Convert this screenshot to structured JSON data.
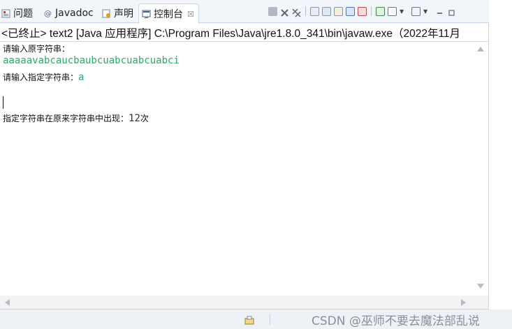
{
  "tabs": [
    {
      "label": "问题",
      "icon": "problems-icon"
    },
    {
      "label": "Javadoc",
      "icon": "javadoc-icon"
    },
    {
      "label": "声明",
      "icon": "declaration-icon"
    },
    {
      "label": "控制台",
      "icon": "console-icon",
      "active": true,
      "close": "☒"
    }
  ],
  "console": {
    "header": "<已终止> text2 [Java 应用程序] C:\\Program Files\\Java\\jre1.8.0_341\\bin\\javaw.exe（2022年11月",
    "prompt1": "请输入原字符串：",
    "input1": "aaaaavabcaucbaubcuabcuabcuabci",
    "prompt2": "请输入指定字符串：",
    "input2": "a",
    "result_label": "指定字符串在原来字符串中出现：",
    "result_value": "12",
    "result_unit": "次"
  },
  "watermark": "CSDN @巫师不要去魔法部乱说",
  "colors": {
    "input_text": "#2fa869",
    "tab_bar": "#f2f5fa",
    "border": "#c8d3e3"
  }
}
